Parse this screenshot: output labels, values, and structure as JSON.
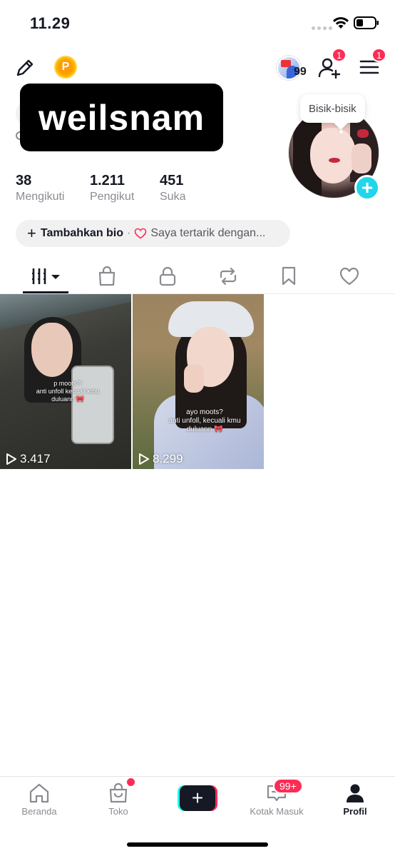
{
  "status_bar": {
    "time": "11.29"
  },
  "header": {
    "coin_letter": "P",
    "badge_count": "99",
    "add_user_notifications": "1",
    "menu_notifications": "1"
  },
  "profile": {
    "username": "weilsnam",
    "tooltip": "Bisik-bisik",
    "stats": [
      {
        "value": "38",
        "label": "Mengikuti"
      },
      {
        "value": "1.211",
        "label": "Pengikut"
      },
      {
        "value": "451",
        "label": "Suka"
      }
    ],
    "bio": {
      "add_label": "Tambahkan bio",
      "separator": "·",
      "interest_label": "Saya tertarik dengan..."
    }
  },
  "tabs": [
    {
      "name": "videos",
      "icon": "grid-icon",
      "active": true
    },
    {
      "name": "shop",
      "icon": "shopping-bag-icon"
    },
    {
      "name": "private",
      "icon": "lock-icon"
    },
    {
      "name": "reposts",
      "icon": "repost-icon"
    },
    {
      "name": "favorites",
      "icon": "bookmark-icon"
    },
    {
      "name": "liked",
      "icon": "heart-icon"
    }
  ],
  "videos": [
    {
      "views": "3.417",
      "caption_lines": [
        "p moots?!",
        "anti unfoll kecuali kmu",
        "duluann 🎀"
      ]
    },
    {
      "views": "8.299",
      "caption_lines": [
        "ayo moots?",
        "anti unfoll, kecuali kmu",
        "duluann 🎀"
      ]
    }
  ],
  "bottom_nav": {
    "home": "Beranda",
    "shop": "Toko",
    "inbox": "Kotak Masuk",
    "inbox_badge": "99+",
    "profile": "Profil"
  },
  "colors": {
    "accent": "#fe2c55",
    "cyan": "#20d5ec",
    "text": "#161823",
    "muted": "#8a8b91"
  }
}
